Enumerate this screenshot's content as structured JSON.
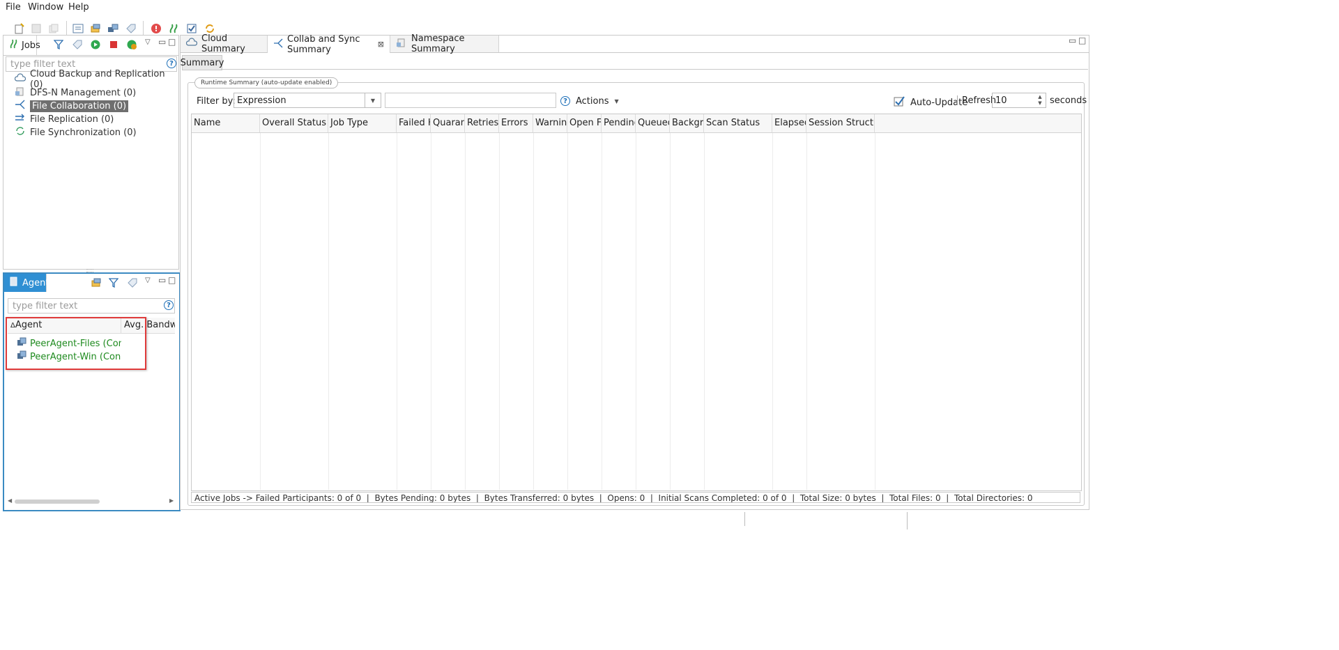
{
  "menu": [
    "File",
    "Window",
    "Help"
  ],
  "jobs_panel": {
    "tab_label": "Jobs",
    "filter_placeholder": "type filter text",
    "items": [
      {
        "label": "Cloud Backup and Replication (0)",
        "icon": "cloud-icon",
        "selected": false
      },
      {
        "label": "DFS-N Management (0)",
        "icon": "dfs-icon",
        "selected": false
      },
      {
        "label": "File Collaboration (0)",
        "icon": "collab-icon",
        "selected": true
      },
      {
        "label": "File Replication (0)",
        "icon": "replication-icon",
        "selected": false
      },
      {
        "label": "File Synchronization (0)",
        "icon": "sync-icon",
        "selected": false
      }
    ]
  },
  "agents_panel": {
    "tab_label": "Agents",
    "filter_placeholder": "type filter text",
    "columns": [
      "Agent",
      "Avg. Bandwidt"
    ],
    "sort_indicator": "Δ",
    "rows": [
      {
        "label": "PeerAgent-Files (Connected",
        "icon": "agent-icon"
      },
      {
        "label": "PeerAgent-Win (Connected",
        "icon": "agent-icon"
      }
    ],
    "row_color": "#1e8a1e",
    "highlight_color": "#e03a3a"
  },
  "editor": {
    "tabs": [
      {
        "label": "Cloud Summary",
        "icon": "cloud-icon",
        "active": false,
        "closable": false
      },
      {
        "label": "Collab and Sync Summary",
        "icon": "collab-icon",
        "active": true,
        "closable": true
      },
      {
        "label": "Namespace Summary",
        "icon": "namespace-icon",
        "active": false,
        "closable": false
      }
    ],
    "subtab": "Summary",
    "group_title": "Runtime Summary (auto-update enabled)",
    "filter_by_label": "Filter by:",
    "filter_by_value": "Expression",
    "actions_label": "Actions",
    "auto_update_label": "Auto-Update",
    "auto_update_checked": true,
    "refresh_label": "Refresh",
    "refresh_value": "10",
    "seconds_label": "seconds",
    "columns": [
      "Name",
      "Overall Status",
      "Job Type",
      "Failed Ho",
      "Quarantir",
      "Retries",
      "Errors",
      "Warnings",
      "Open File",
      "Pending E",
      "Queued I",
      "Backgrou",
      "Scan Status",
      "Elapsed T",
      "Session Structure"
    ],
    "status_bar": "Active Jobs -> Failed Participants: 0 of 0  |  Bytes Pending: 0 bytes  |  Bytes Transferred: 0 bytes  |  Opens: 0  |  Initial Scans Completed: 0 of 0  |  Total Size: 0 bytes  |  Total Files: 0  |  Total Directories: 0"
  },
  "colors": {
    "accent": "#2f8fd3",
    "selection": "#6f6f6f",
    "agent_text": "#1e8a1e",
    "highlight_box": "#e03a3a"
  }
}
